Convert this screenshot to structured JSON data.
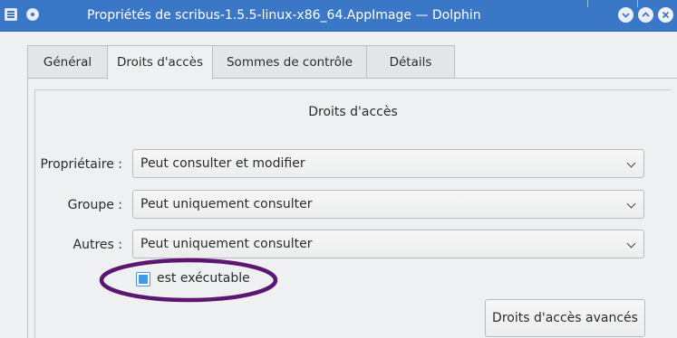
{
  "window": {
    "title": "Propriétés de scribus-1.5.5-linux-x86_64.AppImage — Dolphin",
    "controls": {
      "minimize_icon": "chevron-down-icon",
      "maximize_icon": "chevron-up-icon",
      "close_icon": "close-icon"
    },
    "accent_color": "#3b77c7"
  },
  "tabs": [
    {
      "label": "Général",
      "active": false
    },
    {
      "label": "Droits d'accès",
      "active": true
    },
    {
      "label": "Sommes de contrôle",
      "active": false
    },
    {
      "label": "Détails",
      "active": false
    }
  ],
  "permissions": {
    "section_title": "Droits d'accès",
    "owner": {
      "label": "Propriétaire :",
      "value": "Peut consulter et modifier"
    },
    "group": {
      "label": "Groupe :",
      "value": "Peut uniquement consulter"
    },
    "others": {
      "label": "Autres :",
      "value": "Peut uniquement consulter"
    },
    "executable": {
      "label": "est exécutable",
      "checked": true
    },
    "advanced_button": "Droits d'accès avancés"
  },
  "annotation": {
    "color": "#5a1670"
  }
}
